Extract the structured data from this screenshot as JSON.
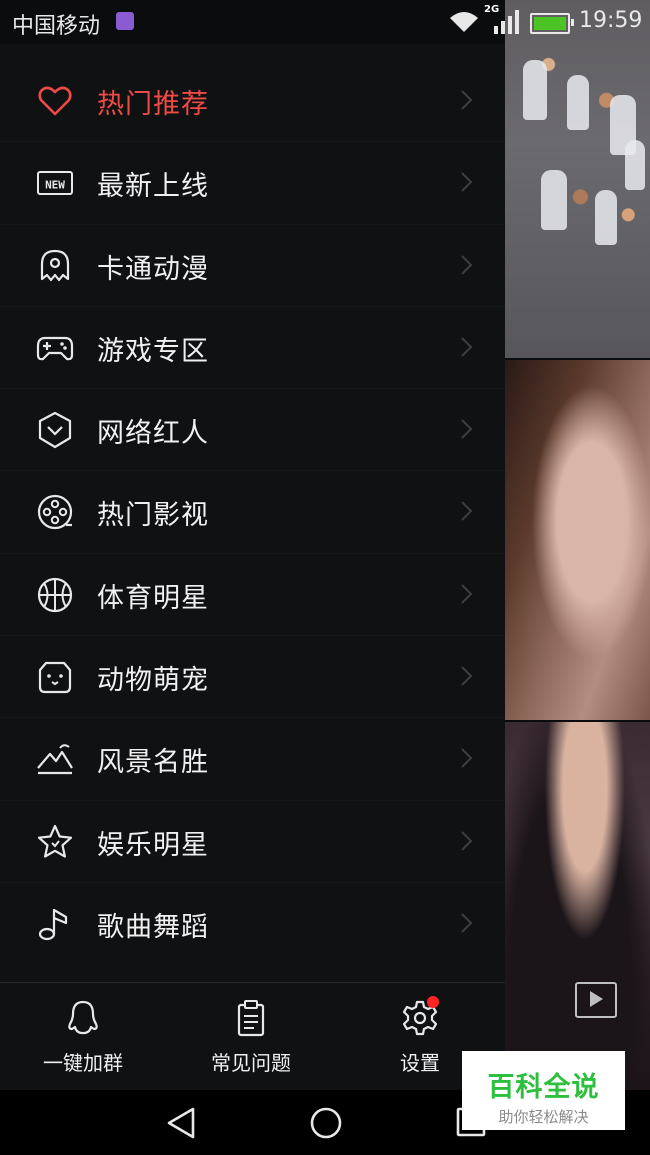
{
  "status_bar": {
    "carrier": "中国移动",
    "network": "2G",
    "time": "19:59",
    "battery_color": "#4dc425"
  },
  "menu": {
    "active_color": "#ef4b46",
    "items": [
      {
        "label": "热门推荐",
        "icon": "heart-icon",
        "active": true
      },
      {
        "label": "最新上线",
        "icon": "new-icon",
        "active": false
      },
      {
        "label": "卡通动漫",
        "icon": "cartoon-icon",
        "active": false
      },
      {
        "label": "游戏专区",
        "icon": "gamepad-icon",
        "active": false
      },
      {
        "label": "网络红人",
        "icon": "shield-icon",
        "active": false
      },
      {
        "label": "热门影视",
        "icon": "film-reel-icon",
        "active": false
      },
      {
        "label": "体育明星",
        "icon": "basketball-icon",
        "active": false
      },
      {
        "label": "动物萌宠",
        "icon": "pet-icon",
        "active": false
      },
      {
        "label": "风景名胜",
        "icon": "mountain-icon",
        "active": false
      },
      {
        "label": "娱乐明星",
        "icon": "star-icon",
        "active": false
      },
      {
        "label": "歌曲舞蹈",
        "icon": "music-note-icon",
        "active": false
      }
    ]
  },
  "bottom_tabs": [
    {
      "label": "一键加群",
      "icon": "qq-penguin-icon"
    },
    {
      "label": "常见问题",
      "icon": "clipboard-icon"
    },
    {
      "label": "设置",
      "icon": "gear-icon",
      "badge": true
    }
  ],
  "watermark": {
    "title": "百科全说",
    "subtitle": "助你轻松解决"
  }
}
